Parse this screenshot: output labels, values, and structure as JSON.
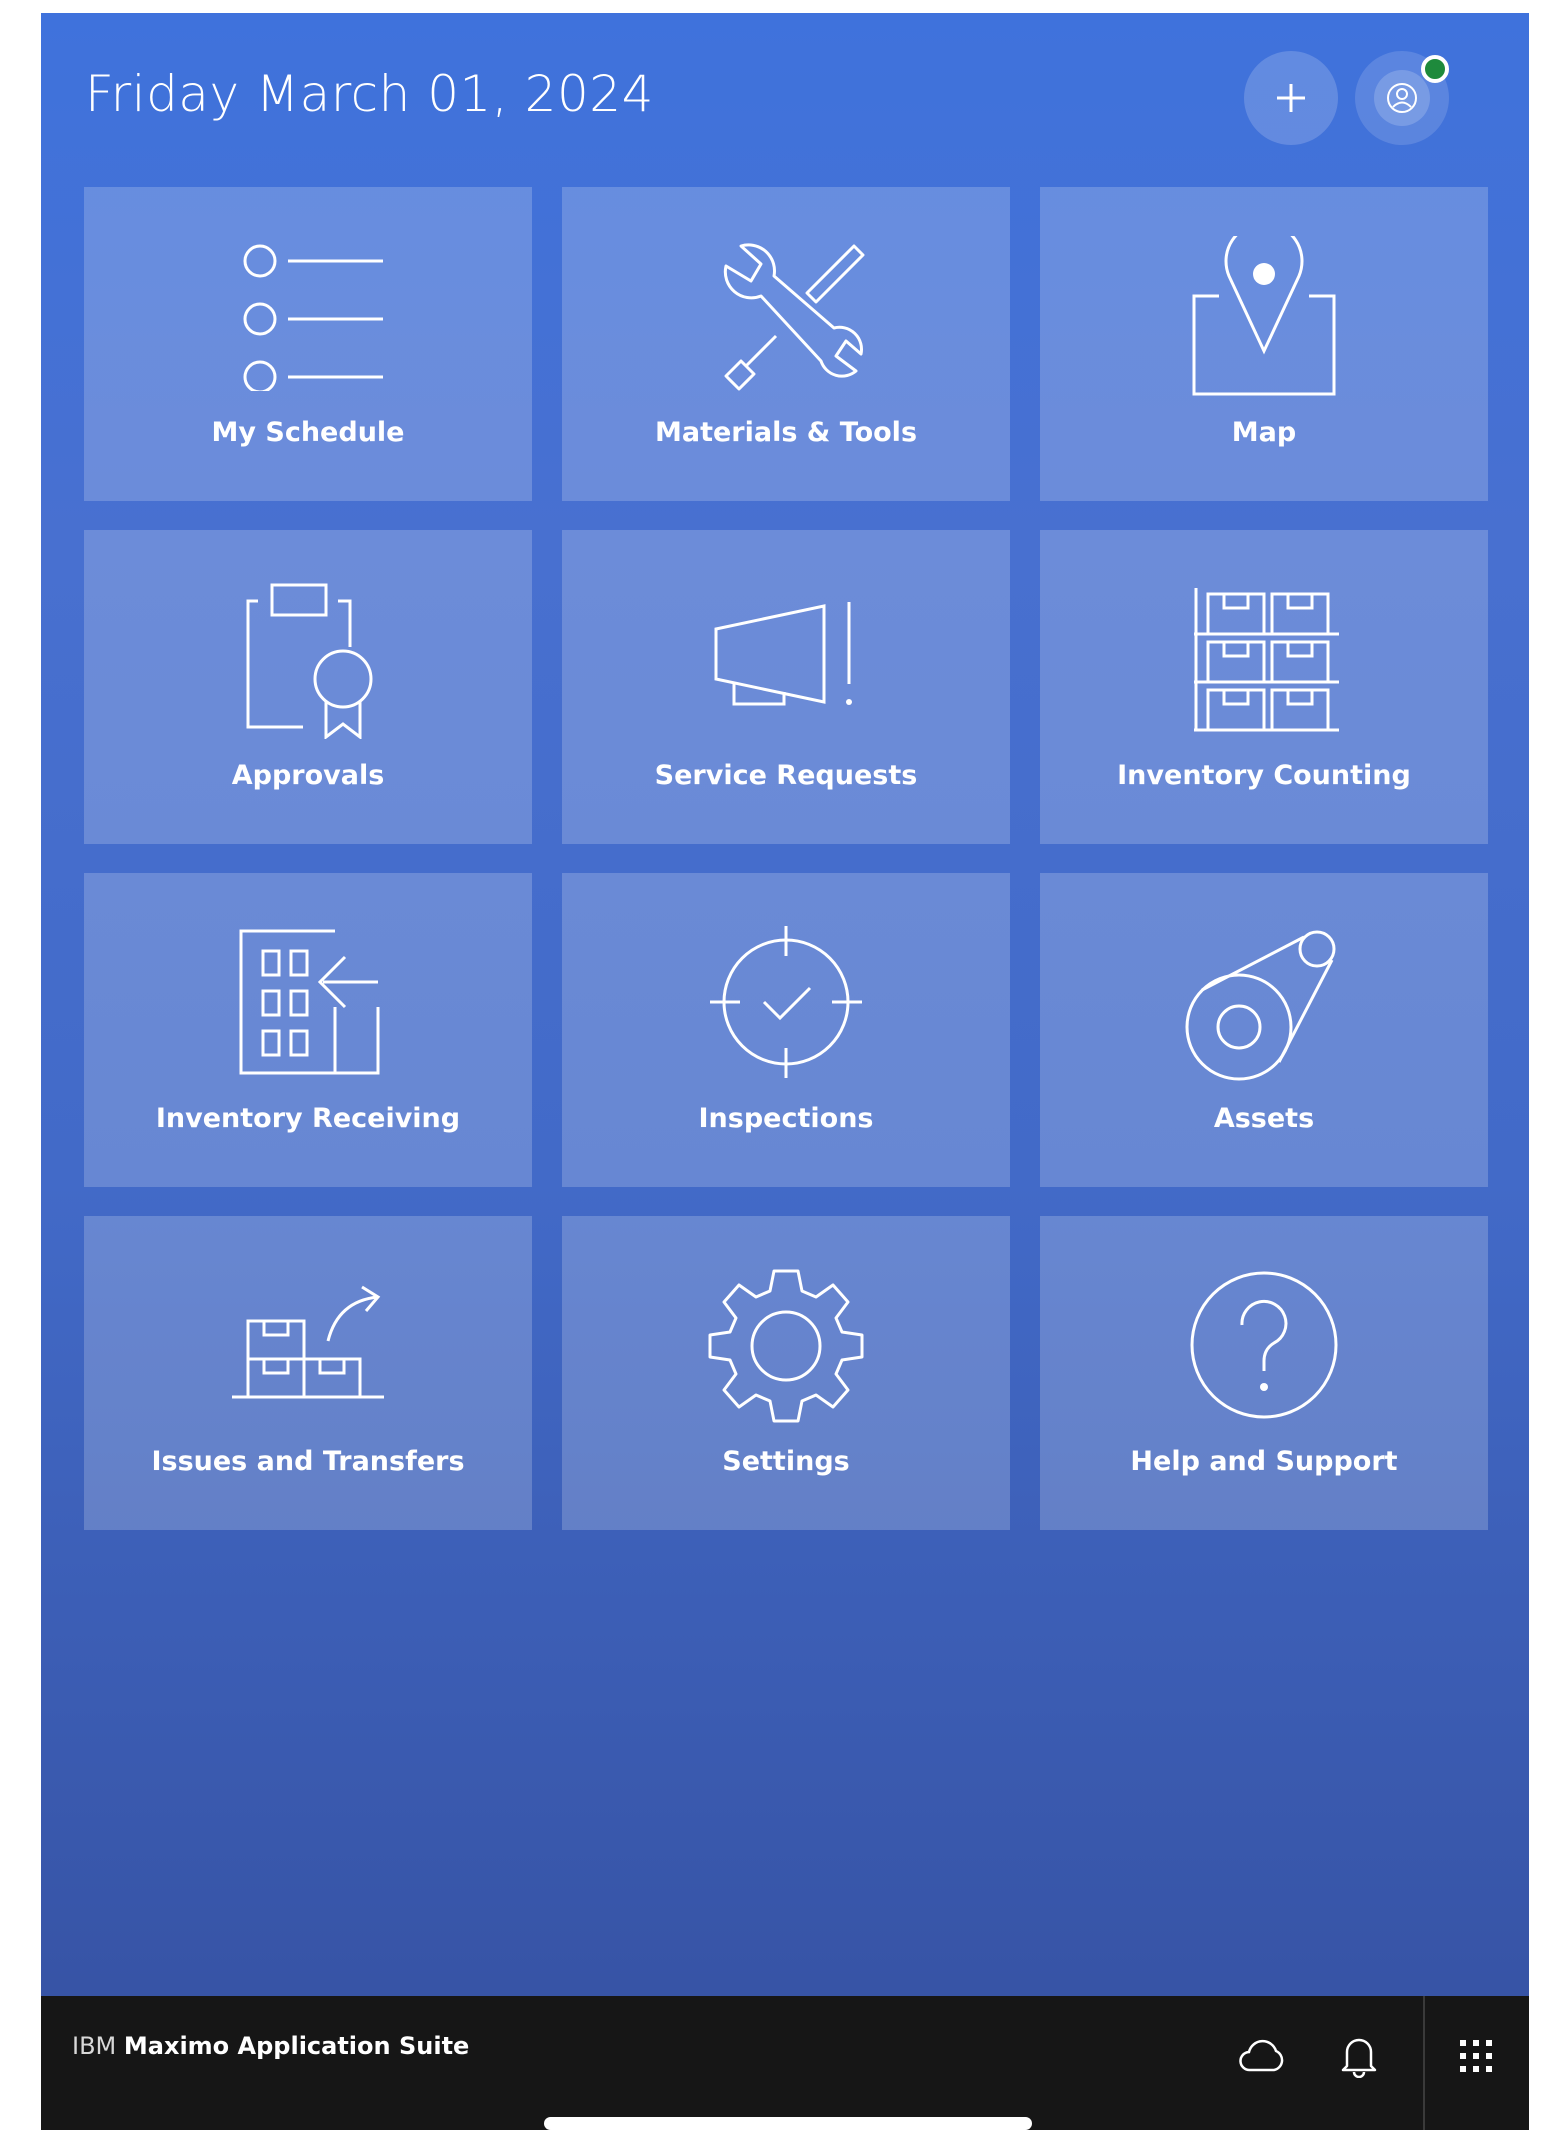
{
  "header": {
    "date": "Friday March 01, 2024"
  },
  "tiles": [
    {
      "label": "My Schedule",
      "icon": "list-icon"
    },
    {
      "label": "Materials & Tools",
      "icon": "tools-icon"
    },
    {
      "label": "Map",
      "icon": "map-pin-icon"
    },
    {
      "label": "Approvals",
      "icon": "clipboard-badge-icon"
    },
    {
      "label": "Service Requests",
      "icon": "megaphone-icon"
    },
    {
      "label": "Inventory Counting",
      "icon": "shelves-icon"
    },
    {
      "label": "Inventory Receiving",
      "icon": "building-receive-icon"
    },
    {
      "label": "Inspections",
      "icon": "target-check-icon"
    },
    {
      "label": "Assets",
      "icon": "pulley-icon"
    },
    {
      "label": "Issues and Transfers",
      "icon": "boxes-transfer-icon"
    },
    {
      "label": "Settings",
      "icon": "gear-icon"
    },
    {
      "label": "Help and Support",
      "icon": "help-icon"
    }
  ],
  "footer": {
    "brand_prefix": "IBM",
    "brand_name": "Maximo Application Suite"
  },
  "colors": {
    "background_top": "#3f72dc",
    "background_bottom": "#3550a0",
    "status_online": "#1e8a3c",
    "footer_bar": "#161616"
  }
}
